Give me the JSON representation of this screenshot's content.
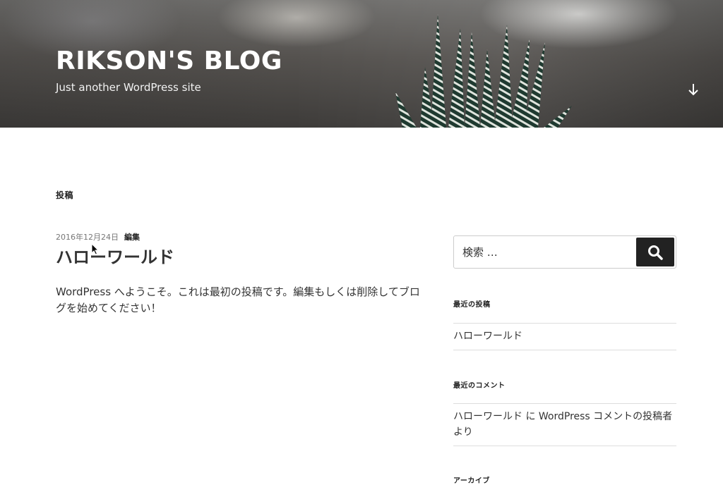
{
  "header": {
    "site_title": "RIKSON'S BLOG",
    "site_description": "Just another WordPress site"
  },
  "main": {
    "page_heading": "投稿",
    "post": {
      "date": "2016年12月24日",
      "edit_label": "編集",
      "title": "ハローワールド",
      "excerpt": "WordPress へようこそ。これは最初の投稿です。編集もしくは削除してブログを始めてください！"
    }
  },
  "sidebar": {
    "search": {
      "placeholder": "検索 …"
    },
    "recent_posts": {
      "title": "最近の投稿",
      "items": [
        "ハローワールド"
      ]
    },
    "recent_comments": {
      "title": "最近のコメント",
      "items": [
        "ハローワールド に WordPress コメントの投稿者 より"
      ]
    },
    "archives": {
      "title": "アーカイブ"
    }
  }
}
